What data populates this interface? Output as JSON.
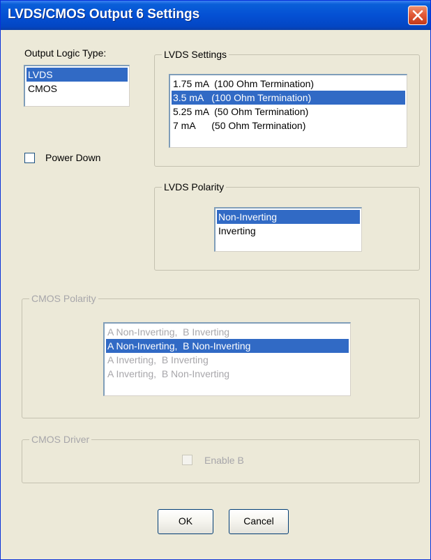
{
  "window": {
    "title": "LVDS/CMOS Output 6 Settings",
    "close_icon": "close-icon"
  },
  "output_logic_type": {
    "label": "Output Logic Type:",
    "options": [
      "LVDS",
      "CMOS"
    ],
    "selected": "LVDS"
  },
  "power_down": {
    "label": "Power Down",
    "checked": false
  },
  "lvds_settings": {
    "title": "LVDS Settings",
    "options": [
      "1.75 mA  (100 Ohm Termination)",
      "3.5 mA   (100 Ohm Termination)",
      "5.25 mA  (50 Ohm Termination)",
      "7 mA      (50 Ohm Termination)"
    ],
    "selected": "3.5 mA   (100 Ohm Termination)"
  },
  "lvds_polarity": {
    "title": "LVDS Polarity",
    "options": [
      "Non-Inverting",
      "Inverting"
    ],
    "selected": "Non-Inverting"
  },
  "cmos_polarity": {
    "title": "CMOS Polarity",
    "enabled": false,
    "options": [
      "A Non-Inverting,  B Inverting",
      "A Non-Inverting,  B Non-Inverting",
      "A Inverting,  B Inverting",
      "A Inverting,  B Non-Inverting"
    ],
    "selected": "A Non-Inverting,  B Non-Inverting"
  },
  "cmos_driver": {
    "title": "CMOS Driver",
    "enabled": false,
    "enable_b_label": "Enable B",
    "enable_b_checked": false
  },
  "buttons": {
    "ok": "OK",
    "cancel": "Cancel"
  },
  "colors": {
    "titlebar": "#0450d4",
    "selection": "#316ac5",
    "dialog_bg": "#ece9d8",
    "disabled_text": "#a7a6aa",
    "close_button": "#e25a37"
  }
}
